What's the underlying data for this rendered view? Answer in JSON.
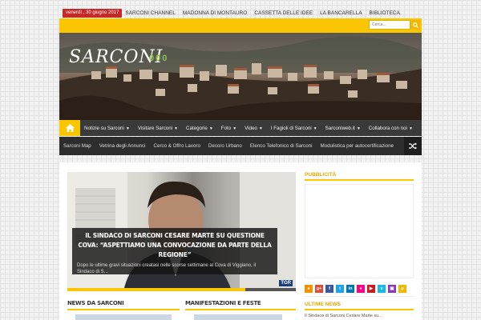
{
  "topbar": {
    "date": "venerdì , 30 giugno 2017",
    "links": [
      "SARCONI CHANNEL",
      "MADONNA DI MONTAURO",
      "CASSETTA DELLE IDEE",
      "LA BANCARELLA",
      "BIBLIOTECA"
    ]
  },
  "header": {
    "logo": "SARCONI",
    "logo_sub": "000",
    "search_placeholder": "Cerca..."
  },
  "nav": {
    "items": [
      {
        "label": "Notizie su Sarconi",
        "dropdown": true
      },
      {
        "label": "Visitare Sarconi",
        "dropdown": true
      },
      {
        "label": "Categorie",
        "dropdown": true
      },
      {
        "label": "Foto",
        "dropdown": true
      },
      {
        "label": "Video",
        "dropdown": true
      },
      {
        "label": "I Fagioli di Sarconi",
        "dropdown": true
      },
      {
        "label": "Sarconiweb.it",
        "dropdown": true
      },
      {
        "label": "Collabora con noi",
        "dropdown": true
      }
    ]
  },
  "subnav": {
    "items": [
      "Sarconi Map",
      "Vetrina degli Annunci",
      "Cerco & Offro Lavoro",
      "Decoro Urbano",
      "Elenco Telefonico di Sarconi",
      "Modulistica per autocertificazione"
    ]
  },
  "slider": {
    "title": "Il Sindaco di Sarconi Cesare Marte su questione Cova: “Aspettiamo una convocazione da parte della Regione”",
    "excerpt": "Dopo le ultime gravi situazioni creatasi nelle scorse settimane al Cova di Viggiano, il Sindaco di S...",
    "progress": 0.78,
    "tv_logo": "TGR"
  },
  "sidebar": {
    "ad_title": "PUBBLICITÀ",
    "latest_title": "ULTIME NEWS",
    "latest_item": "Il Sindaco di Sarconi Cesare Marte su..."
  },
  "socials": [
    {
      "icon": "rss-icon",
      "color": "#f39200",
      "glyph": "●"
    },
    {
      "icon": "google-plus-icon",
      "color": "#dd4b39",
      "glyph": "g+"
    },
    {
      "icon": "facebook-icon",
      "color": "#3b5998",
      "glyph": "f"
    },
    {
      "icon": "twitter-icon",
      "color": "#1da1f2",
      "glyph": "t"
    },
    {
      "icon": "linkedin-icon",
      "color": "#0077b5",
      "glyph": "in"
    },
    {
      "icon": "flickr-icon",
      "color": "#ff0084",
      "glyph": "●"
    },
    {
      "icon": "youtube-icon",
      "color": "#cc181e",
      "glyph": "▶"
    },
    {
      "icon": "vimeo-icon",
      "color": "#1ab7ea",
      "glyph": "v"
    },
    {
      "icon": "instagram-icon",
      "color": "#8a3ab9",
      "glyph": "▣"
    },
    {
      "icon": "pinterest-icon",
      "color": "#f0b800",
      "glyph": "p"
    }
  ],
  "blocks": {
    "news": "NEWS DA SARCONI",
    "events": "MANIFESTAZIONI E FESTE"
  },
  "colors": {
    "accent": "#f9c600",
    "date_badge": "#c62828",
    "nav_bg": "#3a3a3a"
  }
}
